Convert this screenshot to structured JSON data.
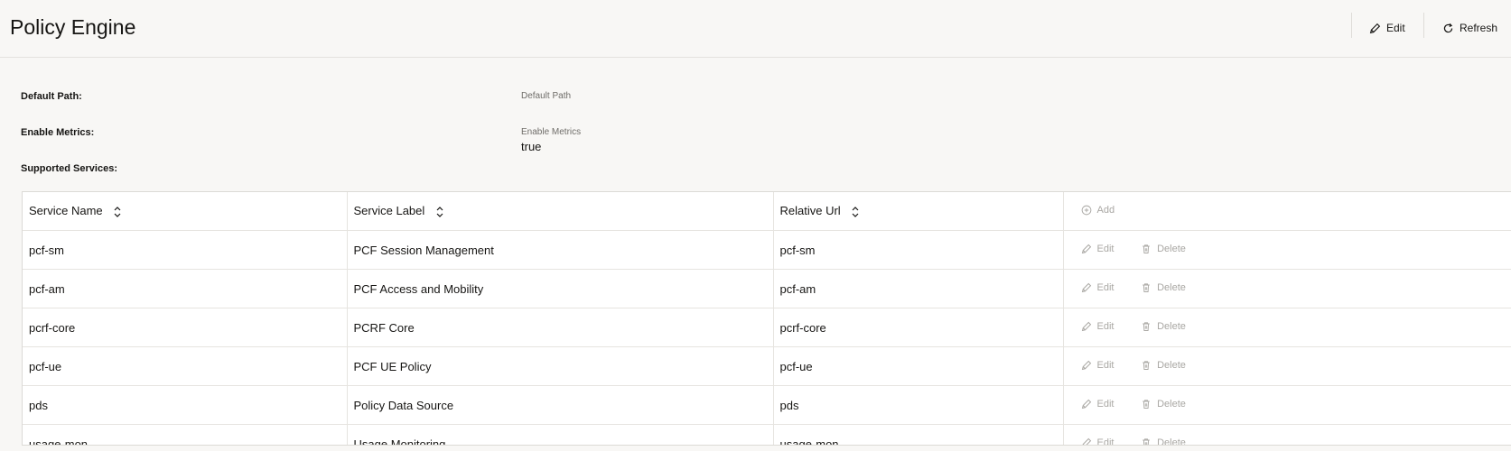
{
  "header": {
    "title": "Policy Engine",
    "edit_label": "Edit",
    "refresh_label": "Refresh"
  },
  "fields": {
    "default_path": {
      "label": "Default Path:",
      "value_label": "Default Path",
      "value": ""
    },
    "enable_metrics": {
      "label": "Enable Metrics:",
      "value_label": "Enable Metrics",
      "value": "true"
    },
    "supported_services": {
      "label": "Supported Services:"
    }
  },
  "table": {
    "columns": [
      "Service Name",
      "Service Label",
      "Relative Url"
    ],
    "add_label": "Add",
    "edit_label": "Edit",
    "delete_label": "Delete",
    "rows": [
      {
        "name": "pcf-sm",
        "label": "PCF Session Management",
        "url": "pcf-sm"
      },
      {
        "name": "pcf-am",
        "label": "PCF Access and Mobility",
        "url": "pcf-am"
      },
      {
        "name": "pcrf-core",
        "label": "PCRF Core",
        "url": "pcrf-core"
      },
      {
        "name": "pcf-ue",
        "label": "PCF UE Policy",
        "url": "pcf-ue"
      },
      {
        "name": "pds",
        "label": "Policy Data Source",
        "url": "pds"
      },
      {
        "name": "usage-mon",
        "label": "Usage Monitoring",
        "url": "usage-mon"
      }
    ]
  },
  "colors": {
    "background": "#f8f7f5",
    "text": "#161513",
    "disabled_action": "#a9a7a3"
  }
}
